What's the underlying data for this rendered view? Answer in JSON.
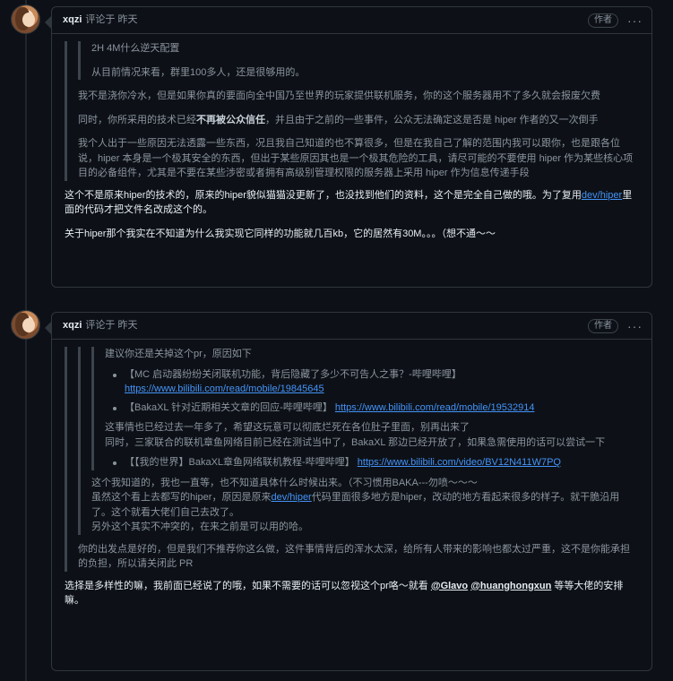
{
  "comments": [
    {
      "author": "xqzi",
      "meta": "评论于 昨天",
      "badge": "作者",
      "kebab": "···",
      "nested_quote": "2H 4M什么逆天配置",
      "quote_p1": "从目前情况来看，群里100多人，还是很够用的。",
      "quote_p2": "我不是浇你冷水，但是如果你真的要面向全中国乃至世界的玩家提供联机服务，你的这个服务器用不了多久就会报废欠费",
      "quote_p3_pre": "同时，你所采用的技术已经",
      "quote_p3_bold": "不再被公众信任",
      "quote_p3_post": "，并且由于之前的一些事件，公众无法确定这是否是 hiper 作者的又一次倒手",
      "quote_p4": "我个人出于一些原因无法透露一些东西，况且我自己知道的也不算很多，但是在我自己了解的范围内我可以跟你，也是跟各位说，hiper 本身是一个极其安全的东西，但出于某些原因其也是一个极其危险的工具，请尽可能的不要使用 hiper 作为某些核心项目的必备组件，尤其是不要在某些涉密或者拥有高级别管理权限的服务器上采用 hiper 作为信息传递手段",
      "reply_p1_pre": "这个不是原来hiper的技术的，原来的hiper貌似猫猫没更新了，也没找到他们的资料，这个是完全自己做的哦。为了复用",
      "reply_p1_link": "dev/hiper",
      "reply_p1_post": "里面的代码才把文件名改成这个的。",
      "reply_p2": "关于hiper那个我实在不知道为什么我实现它同样的功能就几百kb，它的居然有30M。。。（想不通～～"
    },
    {
      "author": "xqzi",
      "meta": "评论于 昨天",
      "badge": "作者",
      "kebab": "···",
      "nested_intro": "建议你还是关掉这个pr，原因如下",
      "li1_text": "【MC 启动器纷纷关闭联机功能，背后隐藏了多少不可告人之事？-哔哩哔哩】",
      "li1_link": "https://www.bilibili.com/read/mobile/19845645",
      "li2_text": "【BakaXL 针对近期相关文章的回应-哔哩哔哩】",
      "li2_link": "https://www.bilibili.com/read/mobile/19532914",
      "nested_p2_line1": "这事情也已经过去一年多了，希望这玩意可以彻底烂死在各位肚子里面，别再出来了",
      "nested_p2_line2": "同时，三家联合的联机章鱼网络目前已经在测试当中了，BakaXL 那边已经开放了，如果急需使用的话可以尝试一下",
      "li3_text": "【【我的世界】BakaXL章鱼网络联机教程-哔哩哔哩】",
      "li3_link": "https://www.bilibili.com/video/BV12N411W7PQ",
      "q_line1": "这个我知道的，我也一直等，也不知道具体什么时候出来。（不习惯用BAKA---勿喷～～～",
      "q_line2_pre": "虽然这个看上去都写的hiper，原因是原来",
      "q_line2_link": "dev/hiper",
      "q_line2_post": "代码里面很多地方是hiper，改动的地方看起来很多的样子。就干脆沿用了。这个就看大佬们自己去改了。",
      "q_line3": "另外这个其实不冲突的，在来之前是可以用的哈。",
      "q_p_last": "你的出发点是好的，但是我们不推荐你这么做，这件事情背后的浑水太深，给所有人带来的影响也都太过严重，这不是你能承担的负担，所以请关闭此 PR",
      "reply_pre": "选择是多样性的嘛，我前面已经说了的哦，如果不需要的话可以忽视这个pr咯～就看 ",
      "mention1": "@Glavo",
      "mention2": "@huanghongxun",
      "reply_post": " 等等大佬的安排嘛。"
    }
  ]
}
